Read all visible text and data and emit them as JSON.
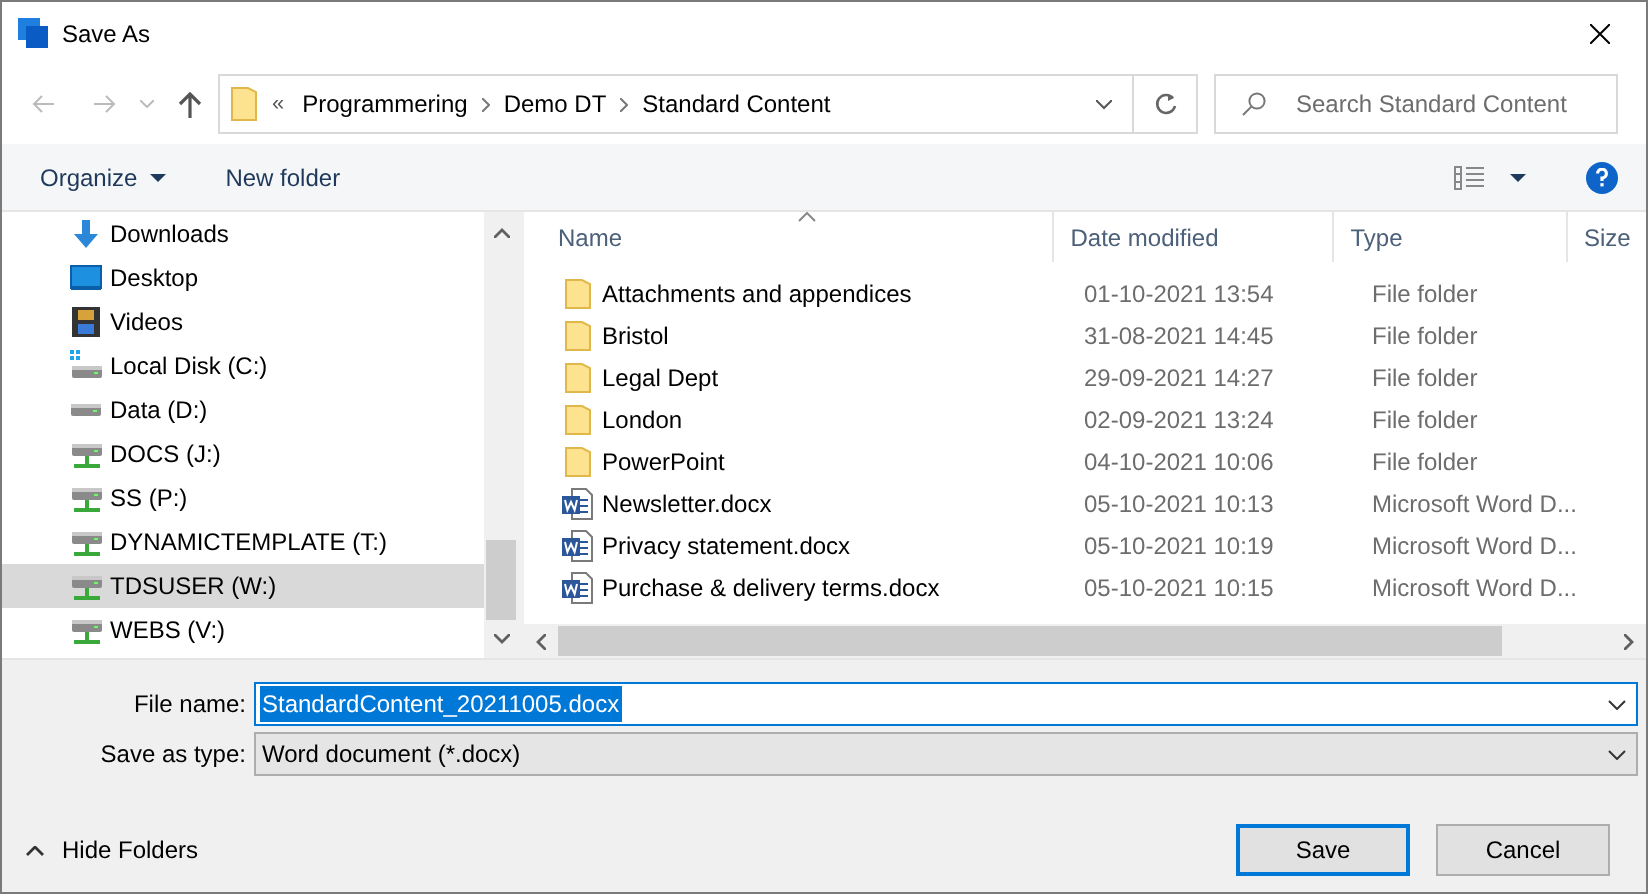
{
  "window": {
    "title": "Save As"
  },
  "address_bar": {
    "overflow": "«",
    "path": [
      "Programmering",
      "Demo DT",
      "Standard Content"
    ]
  },
  "search": {
    "placeholder": "Search Standard Content"
  },
  "toolbar": {
    "organize": "Organize",
    "new_folder": "New folder"
  },
  "navigation": [
    {
      "label": "Downloads",
      "kind": "download",
      "selected": false
    },
    {
      "label": "Desktop",
      "kind": "desktop",
      "selected": false
    },
    {
      "label": "Videos",
      "kind": "video",
      "selected": false
    },
    {
      "label": "Local Disk (C:)",
      "kind": "system_drive",
      "selected": false
    },
    {
      "label": "Data (D:)",
      "kind": "drive",
      "selected": false
    },
    {
      "label": "DOCS (J:)",
      "kind": "network_drive",
      "selected": false
    },
    {
      "label": "SS (P:)",
      "kind": "network_drive",
      "selected": false
    },
    {
      "label": "DYNAMICTEMPLATE (T:)",
      "kind": "network_drive",
      "selected": false
    },
    {
      "label": "TDSUSER (W:)",
      "kind": "network_drive",
      "selected": true
    },
    {
      "label": "WEBS (V:)",
      "kind": "network_drive",
      "selected": false
    }
  ],
  "file_list": {
    "columns": [
      "Name",
      "Date modified",
      "Type",
      "Size"
    ],
    "rows": [
      {
        "kind": "folder",
        "name": "Attachments and appendices",
        "date": "01-10-2021 13:54",
        "type": "File folder"
      },
      {
        "kind": "folder",
        "name": "Bristol",
        "date": "31-08-2021 14:45",
        "type": "File folder"
      },
      {
        "kind": "folder",
        "name": "Legal Dept",
        "date": "29-09-2021 14:27",
        "type": "File folder"
      },
      {
        "kind": "folder",
        "name": "London",
        "date": "02-09-2021 13:24",
        "type": "File folder"
      },
      {
        "kind": "folder",
        "name": "PowerPoint",
        "date": "04-10-2021 10:06",
        "type": "File folder"
      },
      {
        "kind": "word",
        "name": "Newsletter.docx",
        "date": "05-10-2021 10:13",
        "type": "Microsoft Word D..."
      },
      {
        "kind": "word",
        "name": "Privacy statement.docx",
        "date": "05-10-2021 10:19",
        "type": "Microsoft Word D..."
      },
      {
        "kind": "word",
        "name": "Purchase & delivery terms.docx",
        "date": "05-10-2021 10:15",
        "type": "Microsoft Word D..."
      }
    ]
  },
  "file_name": {
    "label": "File name:",
    "value": "StandardContent_20211005.docx",
    "selected": true
  },
  "save_as_type": {
    "label": "Save as type:",
    "value": "Word document (*.docx)"
  },
  "hide_folders": "Hide Folders",
  "buttons": [
    {
      "label": "Save",
      "default": true
    },
    {
      "label": "Cancel",
      "default": false
    }
  ]
}
